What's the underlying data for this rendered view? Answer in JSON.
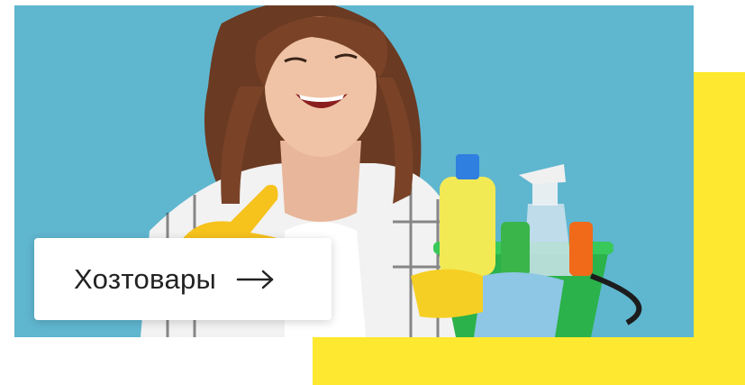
{
  "banner": {
    "category_label": "Хозтовары",
    "icon": "arrow-right-icon",
    "colors": {
      "background": "#5fb6cf",
      "accent_yellow": "#ffe930",
      "card": "#ffffff",
      "text": "#222222"
    }
  }
}
